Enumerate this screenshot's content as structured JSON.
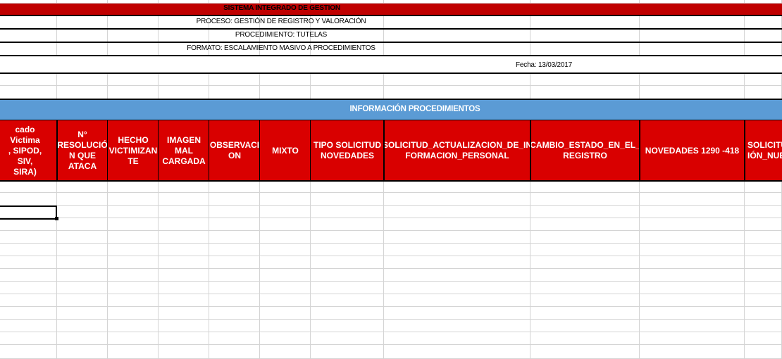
{
  "sheet": {
    "title": "SISTEMA INTEGRADO DE GESTION",
    "proceso": "PROCESO:  GESTIÓN DE REGISTRO Y VALORACIÓN",
    "procedimiento": "PROCEDIMIENTO: TUTELAS",
    "formato": "FORMATO: ESCALAMIENTO MASIVO A PROCEDIMIENTOS",
    "fecha": "Fecha:  13/03/2017",
    "section_title": "INFORMACIÓN PROCEDIMIENTOS"
  },
  "columns": [
    {
      "label": "cado Victima\n, SIPOD, SIV,\nSIRA)"
    },
    {
      "label": "N°\nRESOLUCIÓ\nN QUE\nATACA"
    },
    {
      "label": "HECHO\nVICTIMIZAN\nTE"
    },
    {
      "label": "IMAGEN\nMAL\nCARGADA"
    },
    {
      "label": "OBSERVACI\nON"
    },
    {
      "label": "MIXTO"
    },
    {
      "label": "TIPO SOLICITUD\nNOVEDADES"
    },
    {
      "label": "SOLICITUD_ACTUALIZACION_DE_IN\nFORMACION_PERSONAL"
    },
    {
      "label": "CAMBIO_ESTADO_EN_EL_\nREGISTRO"
    },
    {
      "label": "NOVEDADES 1290 -418"
    },
    {
      "label": "SOLICITU\nIÓN_NUE"
    }
  ],
  "colors": {
    "title_band": "#c00000",
    "section_band": "#5b9bd5",
    "header_fill": "#d90000",
    "grid_line": "#d4d4d4"
  }
}
